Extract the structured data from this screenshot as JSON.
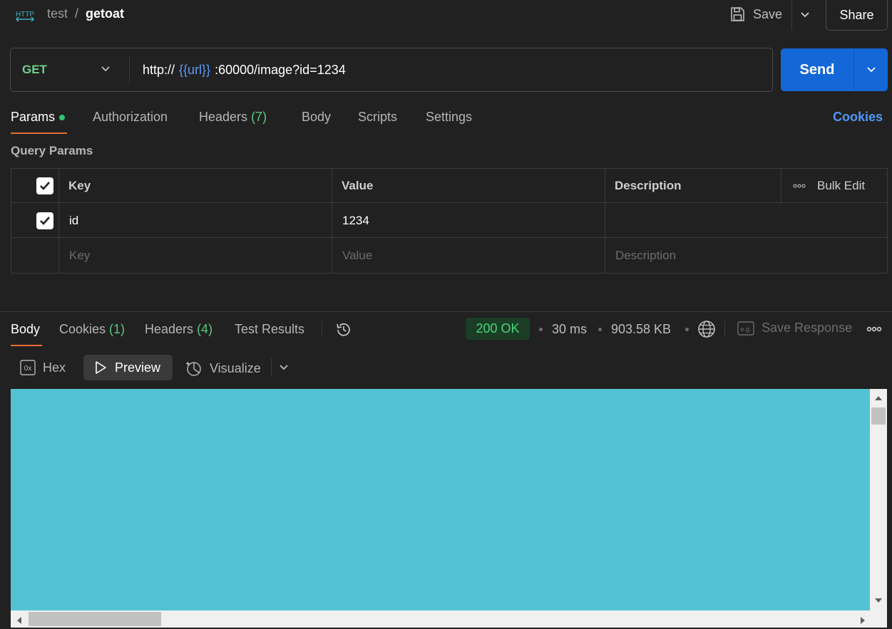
{
  "header": {
    "http_icon_text": "HTTP",
    "breadcrumb_parent": "test",
    "breadcrumb_separator": "/",
    "breadcrumb_current": "getoat",
    "save_label": "Save",
    "share_label": "Share"
  },
  "request": {
    "method": "GET",
    "url_prefix": "http://",
    "url_variable": "{{url}}",
    "url_suffix": ":60000/image?id=1234",
    "send_label": "Send"
  },
  "request_tabs": {
    "params": "Params",
    "authorization": "Authorization",
    "headers": "Headers",
    "headers_count": "(7)",
    "body": "Body",
    "scripts": "Scripts",
    "settings": "Settings",
    "cookies": "Cookies"
  },
  "query_params": {
    "title": "Query Params",
    "columns": [
      "Key",
      "Value",
      "Description"
    ],
    "bulk_edit": "Bulk Edit",
    "rows": [
      {
        "checked": true,
        "key": "id",
        "value": "1234",
        "description": ""
      }
    ],
    "placeholders": {
      "key": "Key",
      "value": "Value",
      "description": "Description"
    }
  },
  "response": {
    "tabs": {
      "body": "Body",
      "cookies": "Cookies",
      "cookies_count": "(1)",
      "headers": "Headers",
      "headers_count": "(4)",
      "test_results": "Test Results"
    },
    "status": "200 OK",
    "time": "30 ms",
    "size": "903.58 KB",
    "save_response": "Save Response",
    "eg_icon_text": "e.g.",
    "view_modes": {
      "hex": "Hex",
      "hex_icon_text": "0x",
      "preview": "Preview",
      "visualize": "Visualize"
    },
    "preview_color": "#53c3d3"
  },
  "colors": {
    "accent_blue": "#1467d6",
    "method_green": "#6fd08c",
    "tab_underline": "#e86a35",
    "status_green": "#4ad57a"
  }
}
